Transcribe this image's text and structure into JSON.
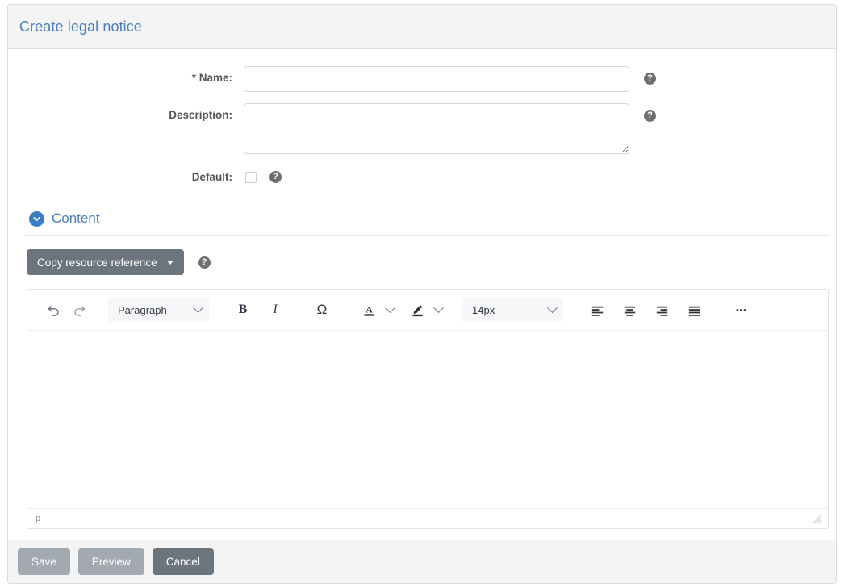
{
  "header": {
    "title": "Create legal notice",
    "title_color": "#4a7ebb",
    "background": "#f4f4f4"
  },
  "form": {
    "fields": [
      {
        "label": "* Name:",
        "type": "text",
        "value": "",
        "placeholder": "",
        "help_icon": "question-mark-circle-icon"
      },
      {
        "label": "Description:",
        "type": "textarea",
        "value": "",
        "placeholder": "",
        "help_icon": "question-mark-circle-icon"
      },
      {
        "label": "Default:",
        "type": "checkbox",
        "checked": false,
        "help_icon": "question-mark-circle-icon"
      }
    ]
  },
  "content_section": {
    "title": "Content",
    "expanded": true,
    "toggle_icon": "chevron-down-circle-icon",
    "toggle_color": "#3b7dc4",
    "copy_reference": {
      "label": "Copy resource reference",
      "caret_icon": "caret-down-icon",
      "background": "#6c757d",
      "help_icon": "question-mark-circle-icon"
    }
  },
  "editor": {
    "toolbar": [
      {
        "name": "undo",
        "icon": "undo-arrow-icon",
        "label": ""
      },
      {
        "name": "redo",
        "icon": "redo-arrow-icon",
        "label": ""
      },
      {
        "name": "block-format",
        "icon": "chevron-down-icon",
        "label": "Paragraph"
      },
      {
        "name": "bold",
        "icon": "bold-icon",
        "label": "B"
      },
      {
        "name": "italic",
        "icon": "italic-icon",
        "label": "I"
      },
      {
        "name": "special-character",
        "icon": "omega-icon",
        "label": "Ω"
      },
      {
        "name": "font-color",
        "icon": "font-color-a-icon",
        "label": "A"
      },
      {
        "name": "font-color-menu",
        "icon": "chevron-down-icon",
        "label": ""
      },
      {
        "name": "highlight-color",
        "icon": "highlighter-pen-icon",
        "label": ""
      },
      {
        "name": "highlight-color-menu",
        "icon": "chevron-down-icon",
        "label": ""
      },
      {
        "name": "font-size",
        "icon": "chevron-down-icon",
        "label": "14px"
      },
      {
        "name": "align-left",
        "icon": "align-left-icon",
        "label": ""
      },
      {
        "name": "align-center",
        "icon": "align-center-icon",
        "label": ""
      },
      {
        "name": "align-right",
        "icon": "align-right-icon",
        "label": ""
      },
      {
        "name": "align-justify",
        "icon": "align-justify-icon",
        "label": ""
      },
      {
        "name": "more-options",
        "icon": "ellipsis-horizontal-icon",
        "label": "•••"
      }
    ],
    "block_format_value": "Paragraph",
    "font_size_value": "14px",
    "body_text": "",
    "status_path": "p",
    "resize_handle": "resize-grip-icon"
  },
  "footer": {
    "buttons": [
      {
        "label": "Save",
        "style": "light"
      },
      {
        "label": "Preview",
        "style": "light"
      },
      {
        "label": "Cancel",
        "style": "dark"
      }
    ],
    "background": "#f4f4f4"
  }
}
